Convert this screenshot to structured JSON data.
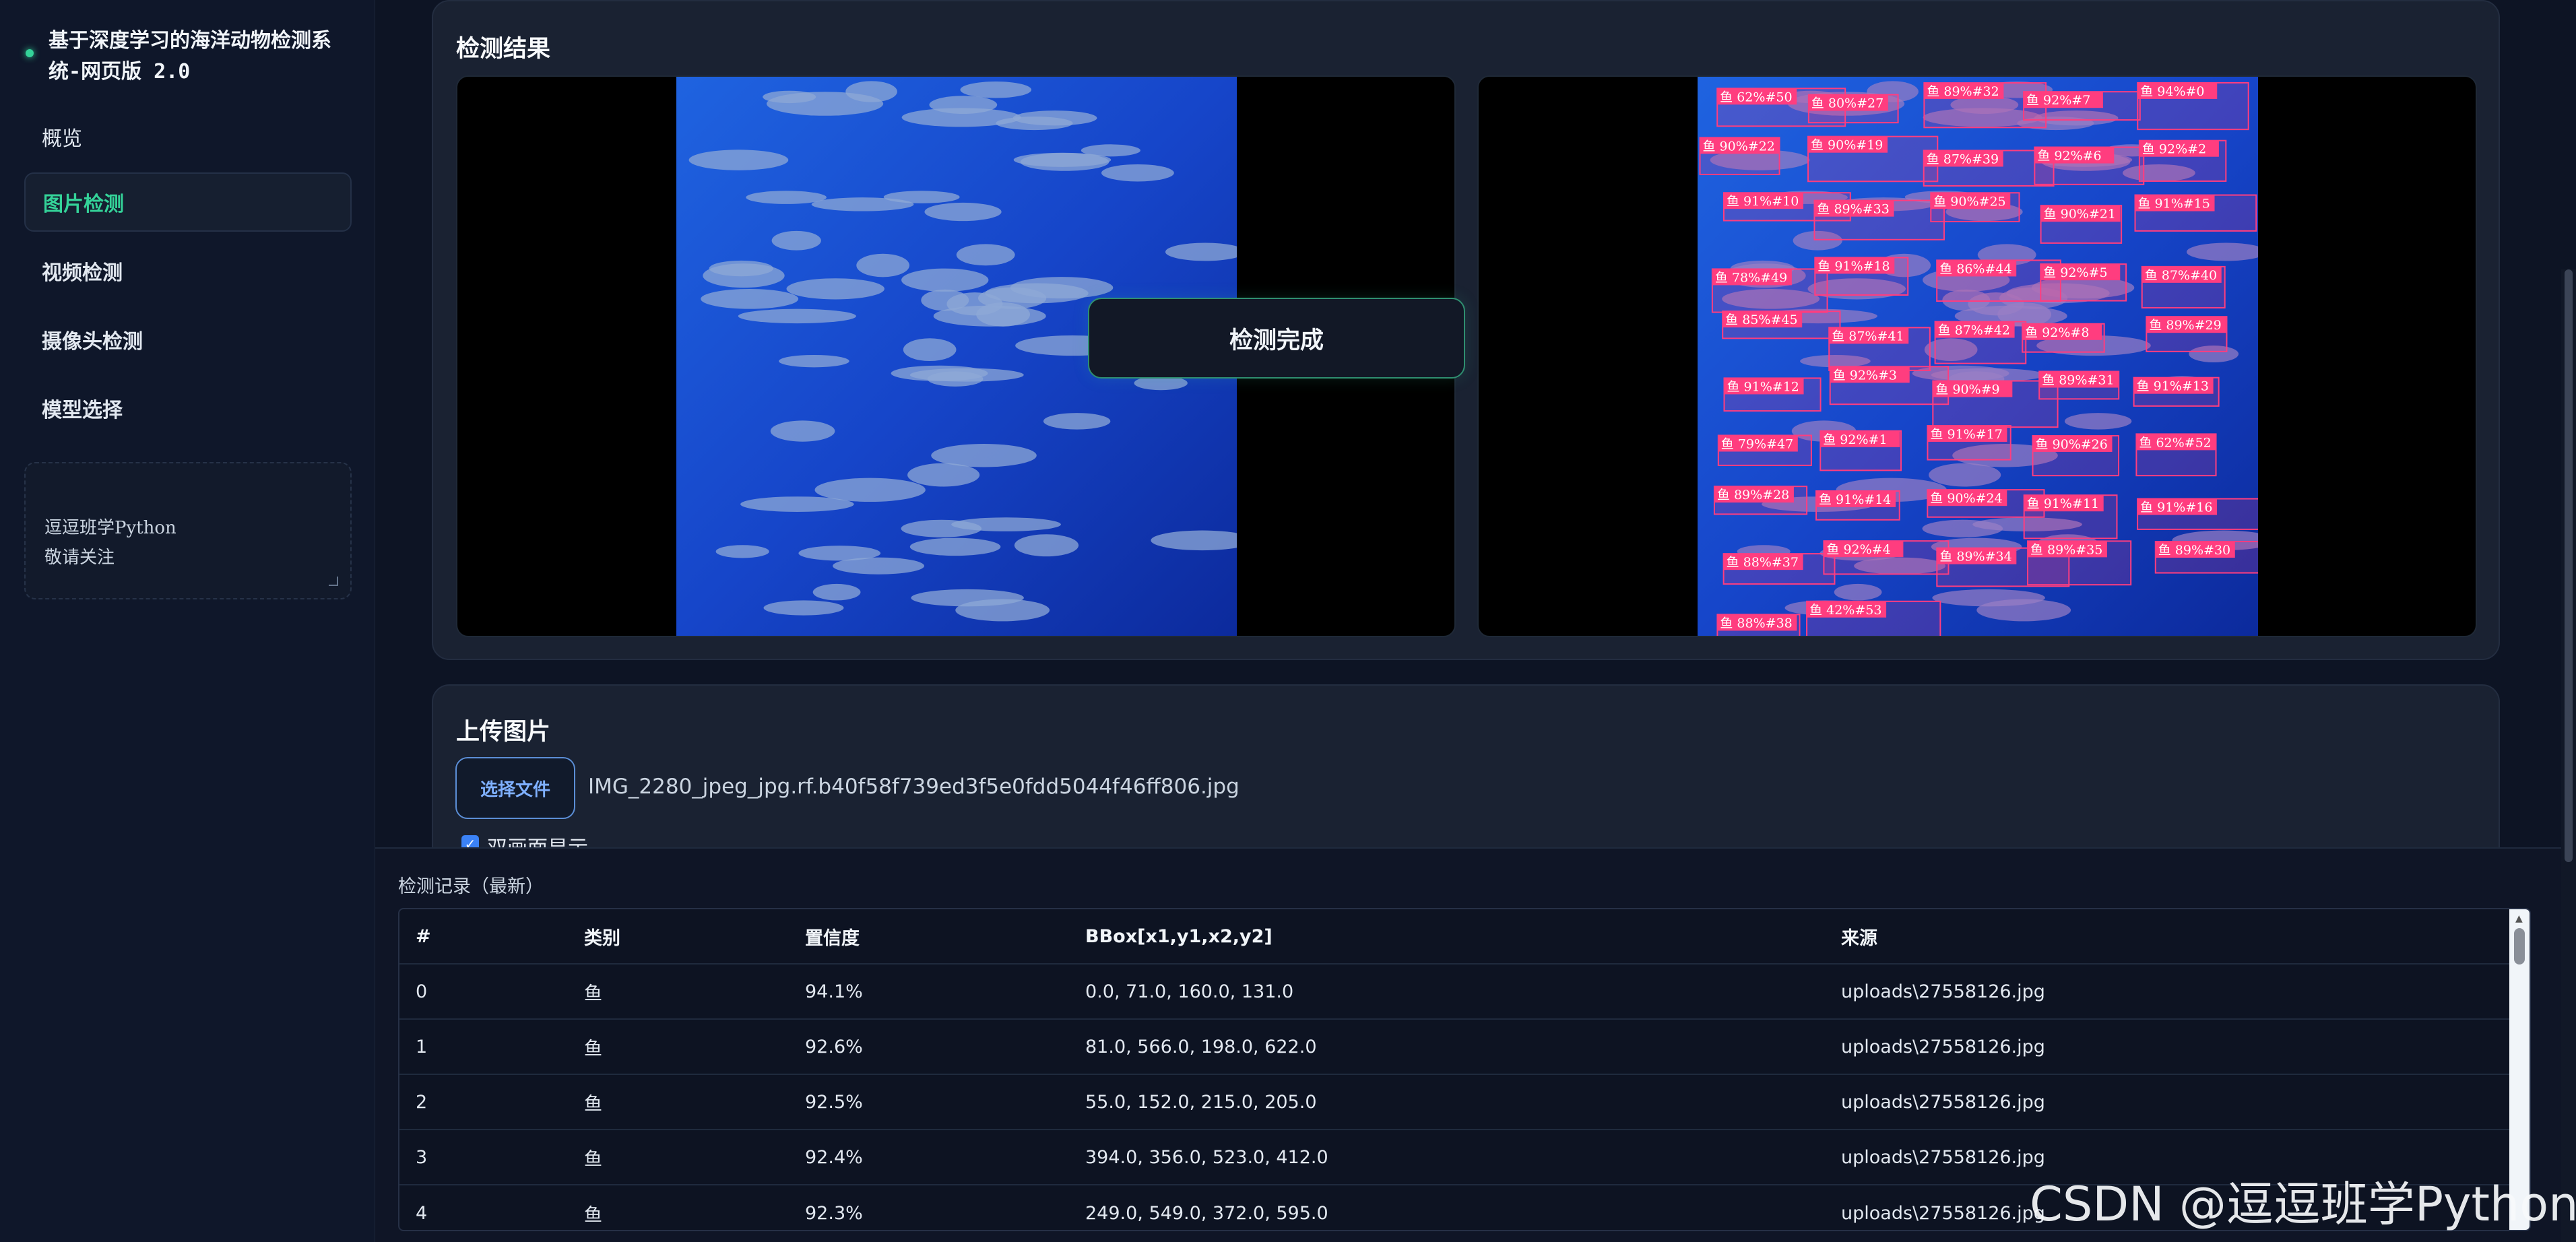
{
  "sidebar": {
    "brand_title": "基于深度学习的海洋动物检测系统-网页版 2.0",
    "nav": [
      "概览",
      "图片检测",
      "视频检测",
      "摄像头检测",
      "模型选择"
    ],
    "active_index": 1,
    "note": "逗逗班学Python\n敬请关注"
  },
  "result": {
    "title": "检测结果",
    "status": "检测完成"
  },
  "upload": {
    "title": "上传图片",
    "choose_file": "选择文件",
    "file_name": "IMG_2280_jpeg_jpg.rf.b40f58f739ed3f5e0fdd5044f46ff806.jpg",
    "checkbox_label": "双画面显示"
  },
  "records": {
    "title": "检测记录（最新）",
    "columns": [
      "#",
      "类别",
      "置信度",
      "BBox[x1,y1,x2,y2]",
      "来源"
    ],
    "rows": [
      [
        "0",
        "鱼",
        "94.1%",
        "0.0, 71.0, 160.0, 131.0",
        "uploads\\27558126.jpg"
      ],
      [
        "1",
        "鱼",
        "92.6%",
        "81.0, 566.0, 198.0, 622.0",
        "uploads\\27558126.jpg"
      ],
      [
        "2",
        "鱼",
        "92.5%",
        "55.0, 152.0, 215.0, 205.0",
        "uploads\\27558126.jpg"
      ],
      [
        "3",
        "鱼",
        "92.4%",
        "394.0, 356.0, 523.0, 412.0",
        "uploads\\27558126.jpg"
      ],
      [
        "4",
        "鱼",
        "92.3%",
        "249.0, 549.0, 372.0, 595.0",
        "uploads\\27558126.jpg"
      ]
    ]
  },
  "detections": [
    "鱼 62%#50",
    "鱼 80%#27",
    "鱼 89%#32",
    "鱼 92%#7",
    "鱼 94%#0",
    "鱼 90%#22",
    "鱼 90%#19",
    "鱼 87%#39",
    "鱼 92%#6",
    "鱼 92%#2",
    "鱼 91%#10",
    "鱼 89%#33",
    "鱼 90%#25",
    "鱼 90%#21",
    "鱼 91%#15",
    "鱼 78%#49",
    "鱼 91%#18",
    "鱼 86%#44",
    "鱼 92%#5",
    "鱼 87%#40",
    "鱼 85%#45",
    "鱼 87%#41",
    "鱼 87%#42",
    "鱼 92%#8",
    "鱼 89%#29",
    "鱼 91%#12",
    "鱼 92%#3",
    "鱼 90%#9",
    "鱼 89%#31",
    "鱼 91%#13",
    "鱼 79%#47",
    "鱼 92%#1",
    "鱼 91%#17",
    "鱼 90%#26",
    "鱼 62%#52",
    "鱼 89%#28",
    "鱼 91%#14",
    "鱼 90%#24",
    "鱼 91%#11",
    "鱼 91%#16",
    "鱼 88%#37",
    "鱼 92%#4",
    "鱼 89%#34",
    "鱼 89%#35",
    "鱼 89%#30",
    "鱼 88%#38",
    "鱼 42%#53"
  ],
  "watermark": "CSDN @逗逗班学Python",
  "colors": {
    "accent": "#34d399",
    "box": "#ff3d7f",
    "link": "#5b8ed6"
  }
}
